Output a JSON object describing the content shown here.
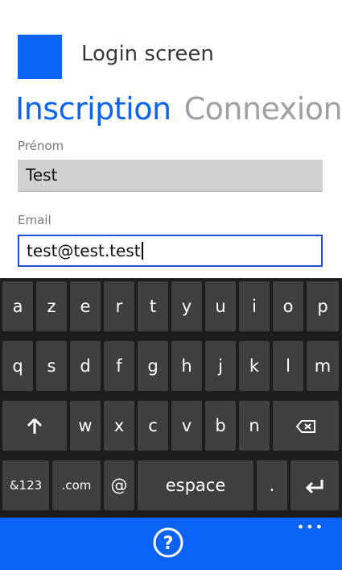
{
  "app": {
    "title": "Login screen",
    "accent_color": "#0a63f5"
  },
  "pivot": {
    "tabs": [
      {
        "label": "Inscription",
        "active": true
      },
      {
        "label": "Connexion",
        "active": false
      }
    ]
  },
  "form": {
    "first_name": {
      "label": "Prénom",
      "value": "Test"
    },
    "email": {
      "label": "Email",
      "value": "test@test.test"
    }
  },
  "keyboard": {
    "row1": [
      "a",
      "z",
      "e",
      "r",
      "t",
      "y",
      "u",
      "i",
      "o",
      "p"
    ],
    "row2": [
      "q",
      "s",
      "d",
      "f",
      "g",
      "h",
      "j",
      "k",
      "l",
      "m"
    ],
    "row3": [
      "w",
      "x",
      "c",
      "v",
      "b",
      "n"
    ],
    "row4": {
      "symbols": "&123",
      "dotcom": ".com",
      "at": "@",
      "space": "espace",
      "period": "."
    },
    "icons": {
      "shift": "shift-arrow-icon",
      "backspace": "backspace-icon",
      "enter": "enter-icon"
    }
  },
  "appbar": {
    "help_icon": "help-icon",
    "more_icon": "more-dots-icon"
  }
}
